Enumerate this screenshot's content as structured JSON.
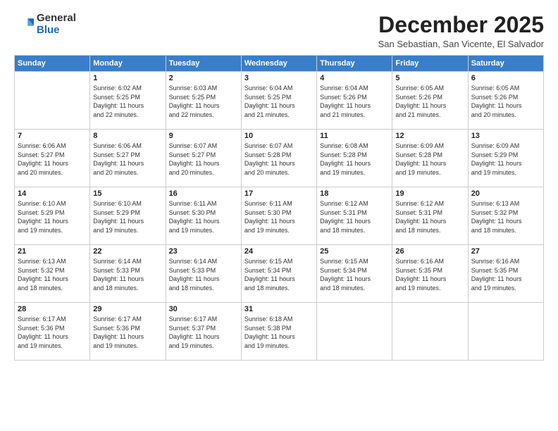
{
  "logo": {
    "general": "General",
    "blue": "Blue"
  },
  "title": "December 2025",
  "location": "San Sebastian, San Vicente, El Salvador",
  "header": {
    "days": [
      "Sunday",
      "Monday",
      "Tuesday",
      "Wednesday",
      "Thursday",
      "Friday",
      "Saturday"
    ]
  },
  "weeks": [
    [
      {
        "num": "",
        "info": ""
      },
      {
        "num": "1",
        "info": "Sunrise: 6:02 AM\nSunset: 5:25 PM\nDaylight: 11 hours\nand 22 minutes."
      },
      {
        "num": "2",
        "info": "Sunrise: 6:03 AM\nSunset: 5:25 PM\nDaylight: 11 hours\nand 22 minutes."
      },
      {
        "num": "3",
        "info": "Sunrise: 6:04 AM\nSunset: 5:25 PM\nDaylight: 11 hours\nand 21 minutes."
      },
      {
        "num": "4",
        "info": "Sunrise: 6:04 AM\nSunset: 5:26 PM\nDaylight: 11 hours\nand 21 minutes."
      },
      {
        "num": "5",
        "info": "Sunrise: 6:05 AM\nSunset: 5:26 PM\nDaylight: 11 hours\nand 21 minutes."
      },
      {
        "num": "6",
        "info": "Sunrise: 6:05 AM\nSunset: 5:26 PM\nDaylight: 11 hours\nand 20 minutes."
      }
    ],
    [
      {
        "num": "7",
        "info": "Sunrise: 6:06 AM\nSunset: 5:27 PM\nDaylight: 11 hours\nand 20 minutes."
      },
      {
        "num": "8",
        "info": "Sunrise: 6:06 AM\nSunset: 5:27 PM\nDaylight: 11 hours\nand 20 minutes."
      },
      {
        "num": "9",
        "info": "Sunrise: 6:07 AM\nSunset: 5:27 PM\nDaylight: 11 hours\nand 20 minutes."
      },
      {
        "num": "10",
        "info": "Sunrise: 6:07 AM\nSunset: 5:28 PM\nDaylight: 11 hours\nand 20 minutes."
      },
      {
        "num": "11",
        "info": "Sunrise: 6:08 AM\nSunset: 5:28 PM\nDaylight: 11 hours\nand 19 minutes."
      },
      {
        "num": "12",
        "info": "Sunrise: 6:09 AM\nSunset: 5:28 PM\nDaylight: 11 hours\nand 19 minutes."
      },
      {
        "num": "13",
        "info": "Sunrise: 6:09 AM\nSunset: 5:29 PM\nDaylight: 11 hours\nand 19 minutes."
      }
    ],
    [
      {
        "num": "14",
        "info": "Sunrise: 6:10 AM\nSunset: 5:29 PM\nDaylight: 11 hours\nand 19 minutes."
      },
      {
        "num": "15",
        "info": "Sunrise: 6:10 AM\nSunset: 5:29 PM\nDaylight: 11 hours\nand 19 minutes."
      },
      {
        "num": "16",
        "info": "Sunrise: 6:11 AM\nSunset: 5:30 PM\nDaylight: 11 hours\nand 19 minutes."
      },
      {
        "num": "17",
        "info": "Sunrise: 6:11 AM\nSunset: 5:30 PM\nDaylight: 11 hours\nand 19 minutes."
      },
      {
        "num": "18",
        "info": "Sunrise: 6:12 AM\nSunset: 5:31 PM\nDaylight: 11 hours\nand 18 minutes."
      },
      {
        "num": "19",
        "info": "Sunrise: 6:12 AM\nSunset: 5:31 PM\nDaylight: 11 hours\nand 18 minutes."
      },
      {
        "num": "20",
        "info": "Sunrise: 6:13 AM\nSunset: 5:32 PM\nDaylight: 11 hours\nand 18 minutes."
      }
    ],
    [
      {
        "num": "21",
        "info": "Sunrise: 6:13 AM\nSunset: 5:32 PM\nDaylight: 11 hours\nand 18 minutes."
      },
      {
        "num": "22",
        "info": "Sunrise: 6:14 AM\nSunset: 5:33 PM\nDaylight: 11 hours\nand 18 minutes."
      },
      {
        "num": "23",
        "info": "Sunrise: 6:14 AM\nSunset: 5:33 PM\nDaylight: 11 hours\nand 18 minutes."
      },
      {
        "num": "24",
        "info": "Sunrise: 6:15 AM\nSunset: 5:34 PM\nDaylight: 11 hours\nand 18 minutes."
      },
      {
        "num": "25",
        "info": "Sunrise: 6:15 AM\nSunset: 5:34 PM\nDaylight: 11 hours\nand 18 minutes."
      },
      {
        "num": "26",
        "info": "Sunrise: 6:16 AM\nSunset: 5:35 PM\nDaylight: 11 hours\nand 19 minutes."
      },
      {
        "num": "27",
        "info": "Sunrise: 6:16 AM\nSunset: 5:35 PM\nDaylight: 11 hours\nand 19 minutes."
      }
    ],
    [
      {
        "num": "28",
        "info": "Sunrise: 6:17 AM\nSunset: 5:36 PM\nDaylight: 11 hours\nand 19 minutes."
      },
      {
        "num": "29",
        "info": "Sunrise: 6:17 AM\nSunset: 5:36 PM\nDaylight: 11 hours\nand 19 minutes."
      },
      {
        "num": "30",
        "info": "Sunrise: 6:17 AM\nSunset: 5:37 PM\nDaylight: 11 hours\nand 19 minutes."
      },
      {
        "num": "31",
        "info": "Sunrise: 6:18 AM\nSunset: 5:38 PM\nDaylight: 11 hours\nand 19 minutes."
      },
      {
        "num": "",
        "info": ""
      },
      {
        "num": "",
        "info": ""
      },
      {
        "num": "",
        "info": ""
      }
    ]
  ]
}
